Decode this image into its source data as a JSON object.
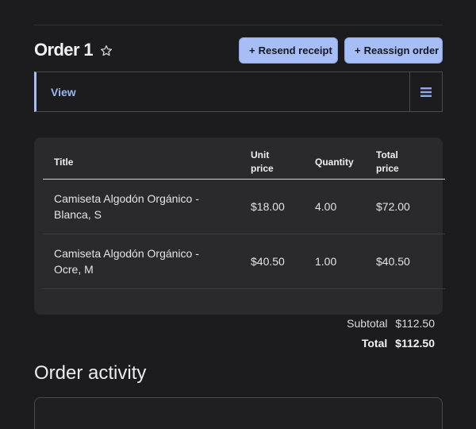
{
  "header": {
    "title": "Order 1",
    "resend_label": "Resend receipt",
    "reassign_label": "Reassign order",
    "plus": "+"
  },
  "view_bar": {
    "tab_label": "View"
  },
  "items_table": {
    "headers": {
      "title": "Title",
      "unit_price_line1": "Unit",
      "unit_price_line2": "price",
      "quantity": "Quantity",
      "total_price_line1": "Total",
      "total_price_line2": "price"
    },
    "rows": [
      {
        "title_line1": "Camiseta Algodón Orgánico -",
        "title_line2": "Blanca, S",
        "unit_price": "$18.00",
        "quantity": "4.00",
        "total_price": "$72.00"
      },
      {
        "title_line1": "Camiseta Algodón Orgánico -",
        "title_line2": "Ocre, M",
        "unit_price": "$40.50",
        "quantity": "1.00",
        "total_price": "$40.50"
      }
    ]
  },
  "totals": {
    "subtotal_label": "Subtotal",
    "subtotal_value": "$112.50",
    "total_label": "Total",
    "total_value": "$112.50"
  },
  "activity": {
    "title": "Order activity"
  },
  "colors": {
    "background": "#1c1c1f",
    "accent": "#a6bdf5",
    "card": "#2a2a2d"
  }
}
